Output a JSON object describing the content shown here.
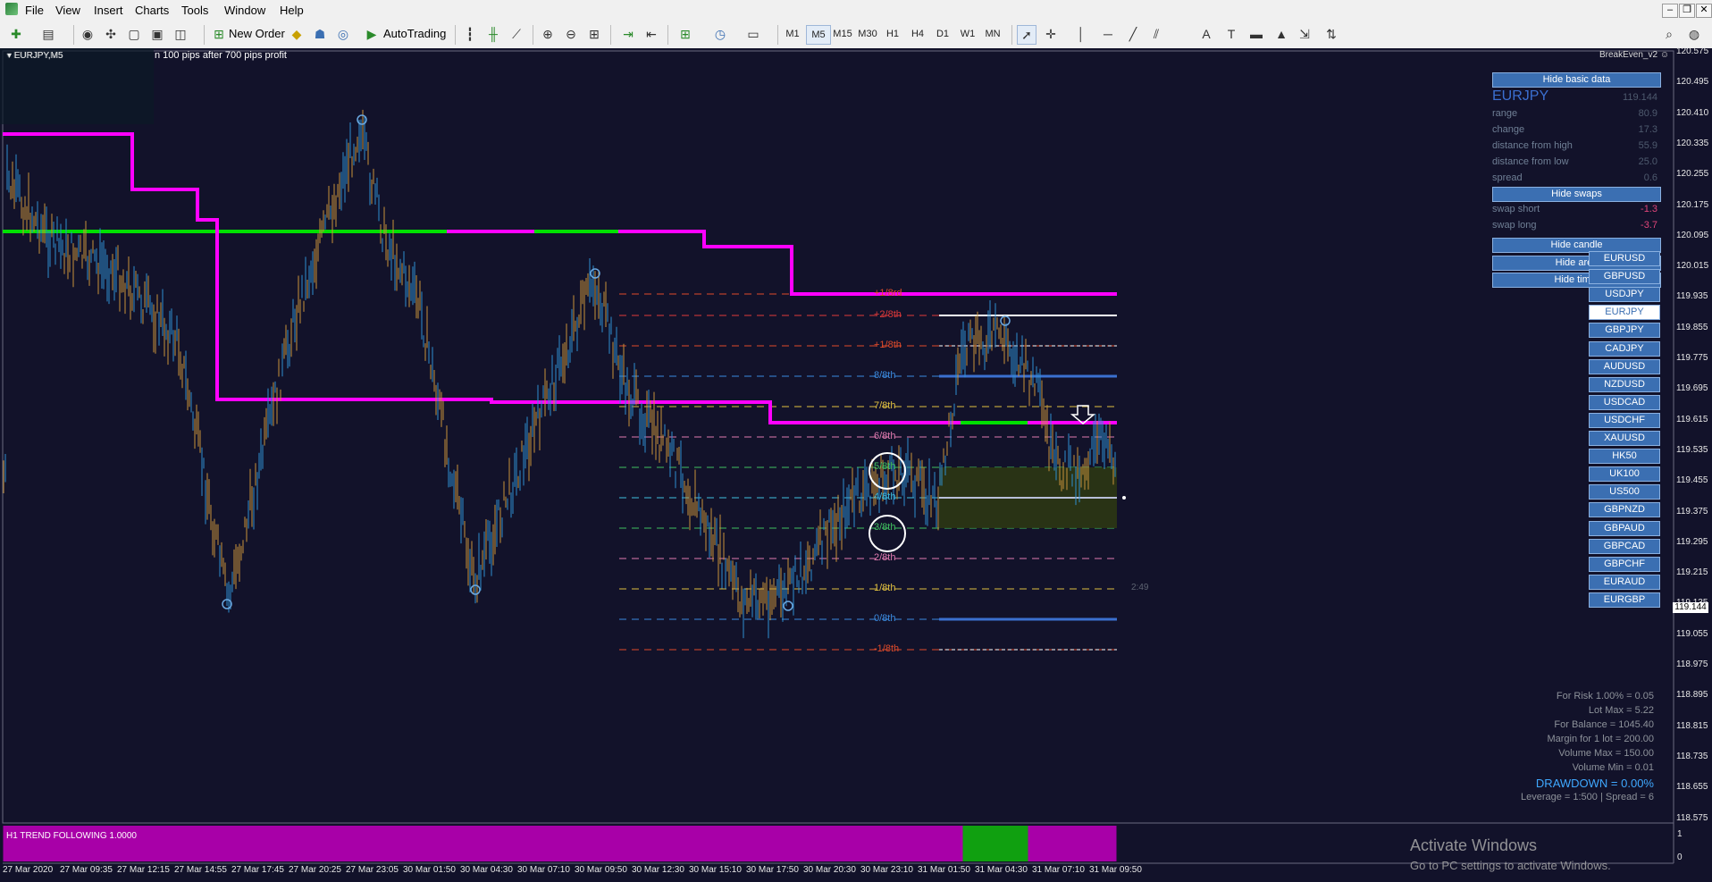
{
  "menu": {
    "items": [
      "File",
      "View",
      "Insert",
      "Charts",
      "Tools",
      "Window",
      "Help"
    ]
  },
  "toolbar": {
    "new_order_label": "New Order",
    "autotrading_label": "AutoTrading",
    "timeframes": [
      "M1",
      "M5",
      "M15",
      "M30",
      "H1",
      "H4",
      "D1",
      "W1",
      "MN"
    ],
    "active_timeframe": "M5"
  },
  "chart": {
    "symbol_label": "EURJPY,M5",
    "alert_text": "n 100 pips after 700 pips profit",
    "ea_label": "BreakEven_v2",
    "countdown": "2:49",
    "current_price": "119.144",
    "indicator_label": "H1 TREND FOLLOWING 1.0000",
    "indicator_scale": [
      "1",
      "0"
    ],
    "price_axis": [
      "120.575",
      "120.495",
      "120.410",
      "120.335",
      "120.255",
      "120.175",
      "120.095",
      "120.015",
      "119.935",
      "119.855",
      "119.775",
      "119.695",
      "119.615",
      "119.535",
      "119.455",
      "119.375",
      "119.295",
      "119.215",
      "119.135",
      "119.055",
      "118.975",
      "118.895",
      "118.815",
      "118.735",
      "118.655",
      "118.575"
    ],
    "time_axis": [
      "27 Mar 2020",
      "27 Mar 09:35",
      "27 Mar 12:15",
      "27 Mar 14:55",
      "27 Mar 17:45",
      "27 Mar 20:25",
      "27 Mar 23:05",
      "30 Mar 01:50",
      "30 Mar 04:30",
      "30 Mar 07:10",
      "30 Mar 09:50",
      "30 Mar 12:30",
      "30 Mar 15:10",
      "30 Mar 17:50",
      "30 Mar 20:30",
      "30 Mar 23:10",
      "31 Mar 01:50",
      "31 Mar 04:30",
      "31 Mar 07:10",
      "31 Mar 09:50"
    ],
    "fib_levels": [
      "+1/8rd",
      "+2/8th",
      "+1/8th",
      "8/8th",
      "7/8th",
      "6/8th",
      "5/8th",
      "4/8th",
      "3/8th",
      "2/8th",
      "1/8th",
      "0/8th",
      "-1/8th"
    ]
  },
  "panel": {
    "hide_basic_data": "Hide basic data",
    "symbol": "EURJPY",
    "symbol_price": "119.144",
    "rows": [
      {
        "label": "range",
        "value": "80.9"
      },
      {
        "label": "change",
        "value": "17.3"
      },
      {
        "label": "distance from high",
        "value": "55.9"
      },
      {
        "label": "distance from low",
        "value": "25.0"
      },
      {
        "label": "spread",
        "value": "0.6"
      }
    ],
    "hide_swaps": "Hide swaps",
    "swaps": [
      {
        "label": "swap short",
        "value": "-1.3"
      },
      {
        "label": "swap long",
        "value": "-3.7"
      }
    ],
    "hide_candle": "Hide candle",
    "hide_area": "Hide area",
    "hide_timer": "Hide timer"
  },
  "symbols": [
    "EURUSD",
    "GBPUSD",
    "USDJPY",
    "EURJPY",
    "GBPJPY",
    "CADJPY",
    "AUDUSD",
    "NZDUSD",
    "USDCAD",
    "USDCHF",
    "XAUUSD",
    "HK50",
    "UK100",
    "US500",
    "GBPNZD",
    "GBPAUD",
    "GBPCAD",
    "GBPCHF",
    "EURAUD",
    "EURGBP"
  ],
  "active_symbol": "EURJPY",
  "risk": {
    "lines": [
      "For Risk 1.00% = 0.05",
      "Lot Max = 5.22",
      "For Balance = 1045.40",
      "Margin for 1 lot = 200.00",
      "Volume Max = 150.00",
      "Volume Min = 0.01"
    ],
    "drawdown": "DRAWDOWN =  0.00%",
    "leverage": "Leverage = 1:500 | Spread = 6"
  },
  "watermark": {
    "title": "Activate Windows",
    "subtitle": "Go to PC settings to activate Windows."
  },
  "colors": {
    "chart_bg": "#12122a",
    "trend_magenta": "#ff00ff",
    "trend_green": "#00e000",
    "candle_blue": "#2f8fd0",
    "candle_orange": "#c8923a",
    "button_blue": "#3b6fb2"
  }
}
